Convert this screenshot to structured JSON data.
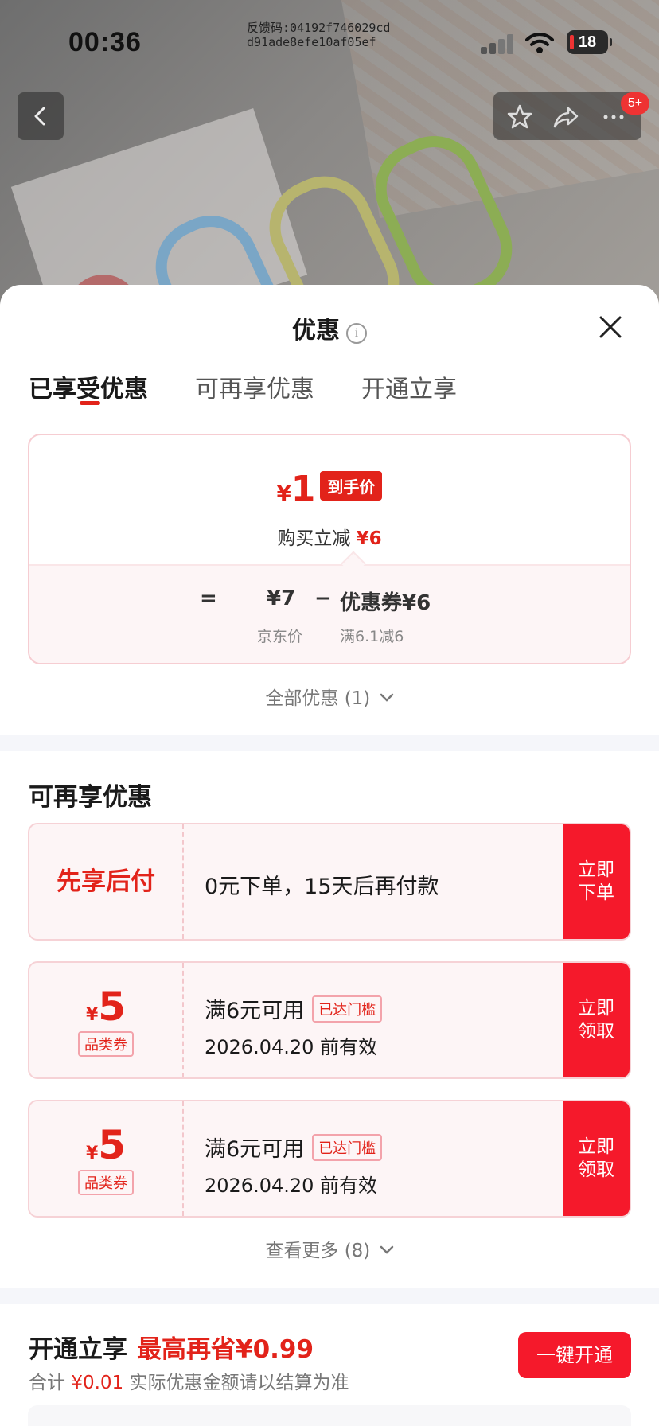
{
  "status_bar": {
    "time": "00:36",
    "feedback_line1": "反馈码:04192f746029cd",
    "feedback_line2": "d91ade8efe10af05ef",
    "battery": "18"
  },
  "header": {
    "badge": "5+"
  },
  "sheet": {
    "title": "优惠",
    "info_glyph": "i",
    "tabs": [
      "已享受优惠",
      "可再享优惠",
      "开通立享"
    ]
  },
  "summary": {
    "currency": "¥",
    "final_price": "1",
    "price_tag": "到手价",
    "reduce_label": "购买立减",
    "reduce_amount": "¥6",
    "equals": "=",
    "jd_price": "¥7",
    "jd_price_label": "京东价",
    "minus": "−",
    "coupon_label": "优惠券¥6",
    "coupon_rule": "满6.1减6"
  },
  "all_offers": "全部优惠 (1)",
  "more_section": {
    "title": "可再享优惠",
    "pay_later": {
      "label": "先享后付",
      "desc": "0元下单，15天后再付款",
      "cta_line1": "立即",
      "cta_line2": "下单"
    },
    "coupons": [
      {
        "currency": "¥",
        "amount": "5",
        "type": "品类券",
        "rule": "满6元可用",
        "status": "已达门槛",
        "valid": "2026.04.20 前有效",
        "cta_line1": "立即",
        "cta_line2": "领取"
      },
      {
        "currency": "¥",
        "amount": "5",
        "type": "品类券",
        "rule": "满6元可用",
        "status": "已达门槛",
        "valid": "2026.04.20 前有效",
        "cta_line1": "立即",
        "cta_line2": "领取"
      }
    ],
    "see_more": "查看更多 (8)"
  },
  "open_section": {
    "title": "开通立享",
    "highlight": "最高再省¥0.99",
    "sub_prefix": "合计",
    "sub_amount": "¥0.01",
    "sub_suffix": "实际优惠金额请以结算为准",
    "button": "一键开通"
  },
  "colors": {
    "accent": "#e2231a",
    "cta": "#f5192b"
  }
}
